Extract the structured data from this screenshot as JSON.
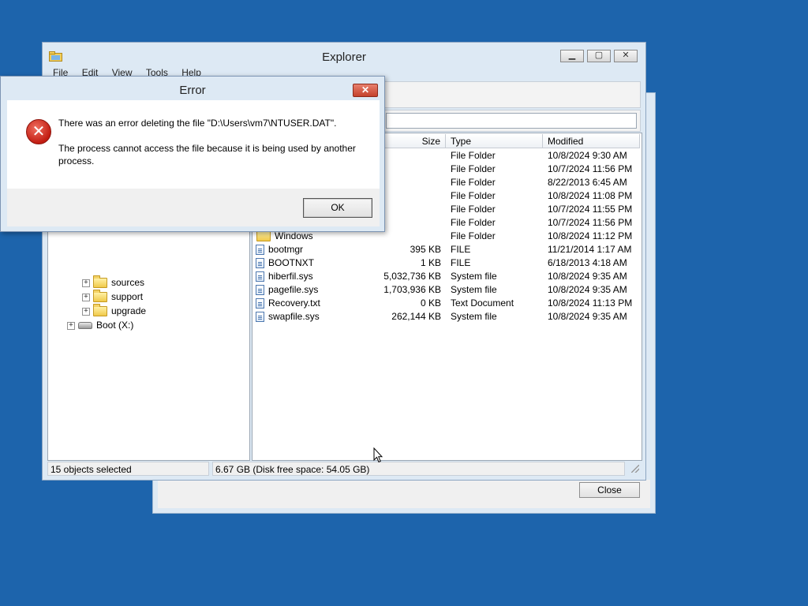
{
  "desktop": {
    "background_color": "#1d64ac"
  },
  "background_window": {
    "close_label": "Close"
  },
  "explorer": {
    "title": "Explorer",
    "menu": [
      "File",
      "Edit",
      "View",
      "Tools",
      "Help"
    ],
    "tree": [
      {
        "label": "sources",
        "icon": "folder-icon"
      },
      {
        "label": "support",
        "icon": "folder-icon"
      },
      {
        "label": "upgrade",
        "icon": "folder-icon"
      },
      {
        "label": "Boot (X:)",
        "icon": "drive-icon"
      }
    ],
    "columns": {
      "size": "Size",
      "type": "Type",
      "modified": "Modified"
    },
    "rows": [
      {
        "name": "",
        "size": "",
        "type": "File Folder",
        "modified": "10/8/2024 9:30 AM"
      },
      {
        "name": "",
        "size": "",
        "type": "File Folder",
        "modified": "10/7/2024 11:56 PM"
      },
      {
        "name": "",
        "size": "",
        "type": "File Folder",
        "modified": "8/22/2013 6:45 AM"
      },
      {
        "name": "",
        "size": "",
        "type": "File Folder",
        "modified": "10/8/2024 11:08 PM"
      },
      {
        "name": "",
        "size": "",
        "type": "File Folder",
        "modified": "10/7/2024 11:55 PM"
      },
      {
        "name": "",
        "size": "",
        "type": "File Folder",
        "modified": "10/7/2024 11:56 PM"
      },
      {
        "name": "Windows",
        "size": "",
        "type": "File Folder",
        "modified": "10/8/2024 11:12 PM"
      },
      {
        "name": "bootmgr",
        "size": "395 KB",
        "type": "FILE",
        "modified": "11/21/2014 1:17 AM"
      },
      {
        "name": "BOOTNXT",
        "size": "1 KB",
        "type": "FILE",
        "modified": "6/18/2013 4:18 AM"
      },
      {
        "name": "hiberfil.sys",
        "size": "5,032,736 KB",
        "type": "System file",
        "modified": "10/8/2024 9:35 AM"
      },
      {
        "name": "pagefile.sys",
        "size": "1,703,936 KB",
        "type": "System file",
        "modified": "10/8/2024 9:35 AM"
      },
      {
        "name": "Recovery.txt",
        "size": "0 KB",
        "type": "Text Document",
        "modified": "10/8/2024 11:13 PM"
      },
      {
        "name": "swapfile.sys",
        "size": "262,144 KB",
        "type": "System file",
        "modified": "10/8/2024 9:35 AM"
      }
    ],
    "status": {
      "selected": "15 objects selected",
      "space": "6.67 GB (Disk free space: 54.05 GB)"
    }
  },
  "error_dialog": {
    "title": "Error",
    "message_line1": "There was an error deleting the file \"D:\\Users\\vm7\\NTUSER.DAT\".",
    "message_line2": "The process cannot access the file because it is being used by another process.",
    "ok_label": "OK"
  }
}
